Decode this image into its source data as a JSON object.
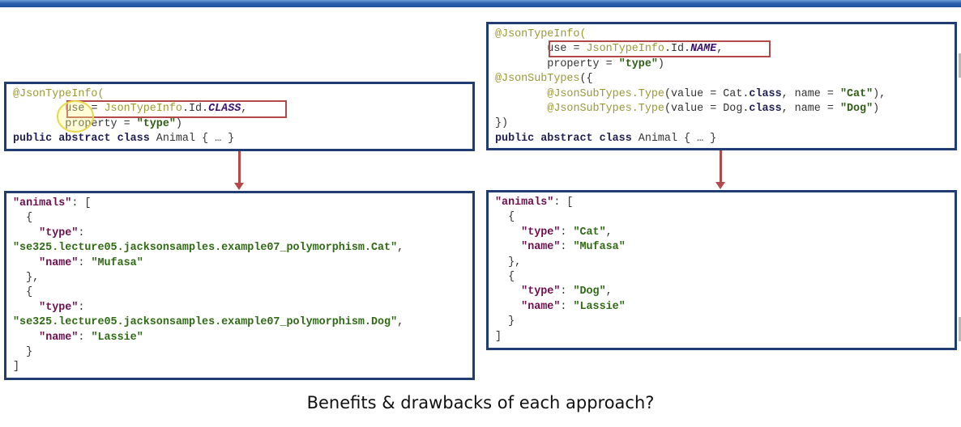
{
  "slide": {
    "question": "Benefits & drawbacks of each approach?"
  },
  "left_annotation": {
    "l1_ann": "@JsonTypeInfo(",
    "l2_indent": "        ",
    "l2_use": "use = ",
    "l2_cls": "JsonTypeInfo",
    "l2_dot": ".Id.",
    "l2_it": "CLASS",
    "l2_comma": ",",
    "l3_prop": "        property = ",
    "l3_str": "\"type\"",
    "l3_close": ")",
    "l4_kw": "public abstract class",
    "l4_rest": " Animal { … }"
  },
  "right_annotation": {
    "l1_ann": "@JsonTypeInfo(",
    "l2_indent": "        ",
    "l2_use": "use = ",
    "l2_cls": "JsonTypeInfo",
    "l2_dot": ".Id.",
    "l2_it": "NAME",
    "l2_comma": ",",
    "l3_prop": "        property = ",
    "l3_str": "\"type\"",
    "l3_close": ")",
    "l4_ann": "@JsonSubTypes",
    "l4_rest": "({",
    "l5_indent": "        ",
    "l5_ann": "@JsonSubTypes.Type",
    "l5_a": "(value = Cat.",
    "l5_kw": "class",
    "l5_b": ", name = ",
    "l5_str": "\"Cat\"",
    "l5_c": "),",
    "l6_indent": "        ",
    "l6_ann": "@JsonSubTypes.Type",
    "l6_a": "(value = Dog.",
    "l6_kw": "class",
    "l6_b": ", name = ",
    "l6_str": "\"Dog\"",
    "l6_c": ")",
    "l7": "})",
    "l8_kw": "public abstract class",
    "l8_rest": " Animal { … }"
  },
  "left_json": {
    "l1_key": "\"animals\"",
    "l1_rest": ": [",
    "l2": "  {",
    "l3_indent": "    ",
    "l3_key": "\"type\"",
    "l3_rest": ":",
    "l4_str": "\"se325.lecture05.jacksonsamples.example07_polymorphism.Cat\"",
    "l4_rest": ",",
    "l5_indent": "    ",
    "l5_key": "\"name\"",
    "l5_sep": ": ",
    "l5_str": "\"Mufasa\"",
    "l6": "  },",
    "l7": "  {",
    "l8_indent": "    ",
    "l8_key": "\"type\"",
    "l8_rest": ":",
    "l9_str": "\"se325.lecture05.jacksonsamples.example07_polymorphism.Dog\"",
    "l9_rest": ",",
    "l10_indent": "    ",
    "l10_key": "\"name\"",
    "l10_sep": ": ",
    "l10_str": "\"Lassie\"",
    "l11": "  }",
    "l12": "]"
  },
  "right_json": {
    "l1_key": "\"animals\"",
    "l1_rest": ": [",
    "l2": "  {",
    "l3_indent": "    ",
    "l3_key": "\"type\"",
    "l3_sep": ": ",
    "l3_str": "\"Cat\"",
    "l3_rest": ",",
    "l4_indent": "    ",
    "l4_key": "\"name\"",
    "l4_sep": ": ",
    "l4_str": "\"Mufasa\"",
    "l5": "  },",
    "l6": "  {",
    "l7_indent": "    ",
    "l7_key": "\"type\"",
    "l7_sep": ": ",
    "l7_str": "\"Dog\"",
    "l7_rest": ",",
    "l8_indent": "    ",
    "l8_key": "\"name\"",
    "l8_sep": ": ",
    "l8_str": "\"Lassie\"",
    "l9": "  }",
    "l10": "]"
  },
  "colors": {
    "box_border": "#1f3c73",
    "highlight": "#b24a4a",
    "annotation": "#9a9a32",
    "json_key": "#6e0e4e",
    "json_string": "#2f6b14"
  }
}
